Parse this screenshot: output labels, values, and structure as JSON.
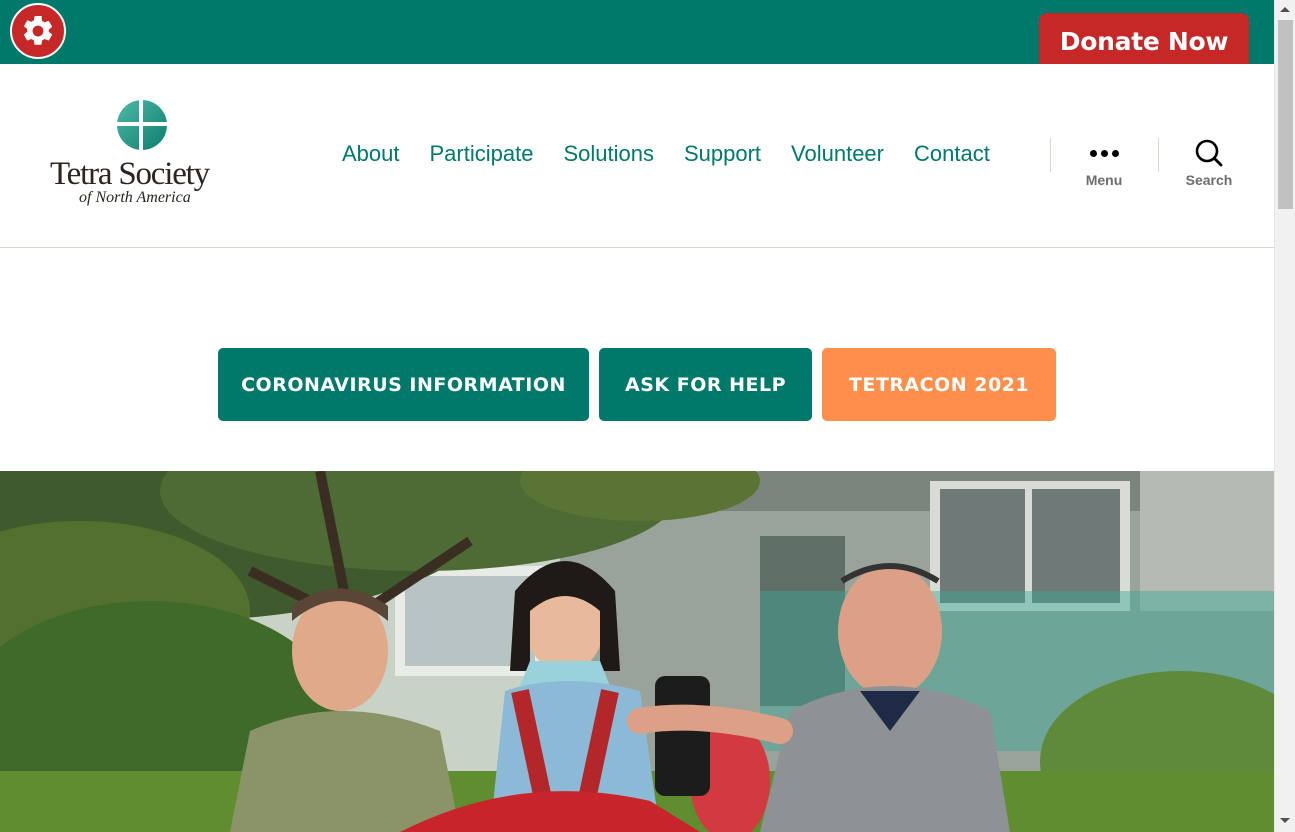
{
  "topbar": {
    "accessibility_icon": "gear-icon",
    "donate_label": "Donate Now",
    "colors": {
      "bar": "#00796b",
      "accent": "#c62828"
    }
  },
  "header": {
    "logo": {
      "name": "Tetra Society",
      "subtitle": "of North America"
    },
    "nav": [
      "About",
      "Participate",
      "Solutions",
      "Support",
      "Volunteer",
      "Contact"
    ],
    "menu_label": "Menu",
    "search_label": "Search",
    "colors": {
      "link": "#00796b",
      "tool_label": "#6d6d6d"
    }
  },
  "cta": {
    "coronavirus": "CORONAVIRUS INFORMATION",
    "help": "ASK FOR HELP",
    "tetracon": "TETRACON 2021",
    "colors": {
      "primary": "#00796b",
      "secondary": "#ff8f4a"
    }
  },
  "hero": {
    "icon": "hero-photo"
  }
}
